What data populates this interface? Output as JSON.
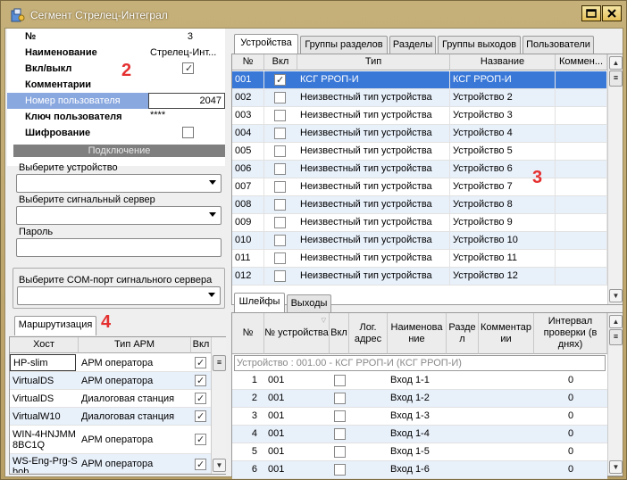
{
  "window": {
    "title": "Сегмент Стрелец-Интеграл"
  },
  "props": {
    "rows": [
      {
        "label": "№",
        "value": "3"
      },
      {
        "label": "Наименование",
        "value": "Стрелец-Инт..."
      },
      {
        "label": "Вкл/выкл",
        "value": ""
      },
      {
        "label": "Комментарии",
        "value": ""
      },
      {
        "label": "Номер пользователя",
        "value": "2047"
      },
      {
        "label": "Ключ пользователя",
        "value": "****"
      },
      {
        "label": "Шифрование",
        "value": ""
      }
    ]
  },
  "connection": {
    "header": "Подключение",
    "device_label": "Выберите устройство",
    "server_label": "Выберите сигнальный сервер",
    "password_label": "Пароль",
    "com_label": "Выберите COM-порт сигнального сервера"
  },
  "annotations": {
    "n2": "2",
    "n3": "3",
    "n4": "4"
  },
  "routing": {
    "tab": "Маршрутизация",
    "columns": [
      "Хост",
      "Тип АРМ",
      "Вкл"
    ],
    "rows": [
      {
        "host": "HP-slim",
        "type": "АРМ оператора"
      },
      {
        "host": "VirtualDS",
        "type": "АРМ оператора"
      },
      {
        "host": "VirtualDS",
        "type": "Диалоговая станция"
      },
      {
        "host": "VirtualW10",
        "type": "Диалоговая станция"
      },
      {
        "host": "WIN-4HNJMM 8BC1Q",
        "type": "АРМ оператора"
      },
      {
        "host": "WS-Eng-Prg-S bob",
        "type": "АРМ оператора"
      }
    ]
  },
  "top_tabs": [
    "Устройства",
    "Группы разделов",
    "Разделы",
    "Группы выходов",
    "Пользователи"
  ],
  "devices": {
    "columns": [
      "№",
      "Вкл",
      "Тип",
      "Название",
      "Коммен..."
    ],
    "rows": [
      {
        "n": "001",
        "type": "КСГ РРОП-И",
        "name": "КСГ РРОП-И"
      },
      {
        "n": "002",
        "type": "Неизвестный тип устройства",
        "name": "Устройство 2"
      },
      {
        "n": "003",
        "type": "Неизвестный тип устройства",
        "name": "Устройство 3"
      },
      {
        "n": "004",
        "type": "Неизвестный тип устройства",
        "name": "Устройство 4"
      },
      {
        "n": "005",
        "type": "Неизвестный тип устройства",
        "name": "Устройство 5"
      },
      {
        "n": "006",
        "type": "Неизвестный тип устройства",
        "name": "Устройство 6"
      },
      {
        "n": "007",
        "type": "Неизвестный тип устройства",
        "name": "Устройство 7"
      },
      {
        "n": "008",
        "type": "Неизвестный тип устройства",
        "name": "Устройство 8"
      },
      {
        "n": "009",
        "type": "Неизвестный тип устройства",
        "name": "Устройство 9"
      },
      {
        "n": "010",
        "type": "Неизвестный тип устройства",
        "name": "Устройство 10"
      },
      {
        "n": "011",
        "type": "Неизвестный тип устройства",
        "name": "Устройство 11"
      },
      {
        "n": "012",
        "type": "Неизвестный тип устройства",
        "name": "Устройство 12"
      }
    ]
  },
  "bottom_tabs": [
    "Шлейфы",
    "Выходы"
  ],
  "loops": {
    "columns": [
      "№",
      "№ устройства",
      "Вкл",
      "Лог. адрес",
      "Наименова ние",
      "Разде л",
      "Комментар ии",
      "Интервал проверки (в днях)"
    ],
    "group": "Устройство : 001.00 - КСГ РРОП-И (КСГ РРОП-И)",
    "rows": [
      {
        "n": "1",
        "dev": "001",
        "name": "Вход 1-1",
        "interval": "0"
      },
      {
        "n": "2",
        "dev": "001",
        "name": "Вход 1-2",
        "interval": "0"
      },
      {
        "n": "3",
        "dev": "001",
        "name": "Вход 1-3",
        "interval": "0"
      },
      {
        "n": "4",
        "dev": "001",
        "name": "Вход 1-4",
        "interval": "0"
      },
      {
        "n": "5",
        "dev": "001",
        "name": "Вход 1-5",
        "interval": "0"
      },
      {
        "n": "6",
        "dev": "001",
        "name": "Вход 1-6",
        "interval": "0"
      }
    ]
  }
}
